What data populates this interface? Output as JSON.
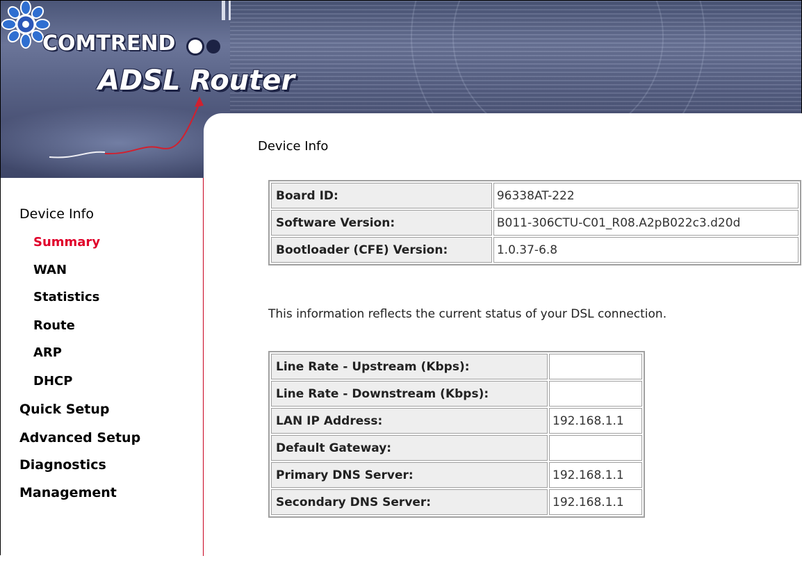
{
  "header": {
    "brand": "COMTREND",
    "product": "ADSL Router"
  },
  "sidebar": {
    "items": [
      {
        "label": "Device Info",
        "level": "top",
        "active": false
      },
      {
        "label": "Summary",
        "level": "sub",
        "active": true
      },
      {
        "label": "WAN",
        "level": "sub",
        "active": false
      },
      {
        "label": "Statistics",
        "level": "sub",
        "active": false
      },
      {
        "label": "Route",
        "level": "sub",
        "active": false
      },
      {
        "label": "ARP",
        "level": "sub",
        "active": false
      },
      {
        "label": "DHCP",
        "level": "sub",
        "active": false
      },
      {
        "label": "Quick Setup",
        "level": "top",
        "active": false
      },
      {
        "label": "Advanced Setup",
        "level": "top",
        "active": false
      },
      {
        "label": "Diagnostics",
        "level": "top",
        "active": false
      },
      {
        "label": "Management",
        "level": "top",
        "active": false
      }
    ]
  },
  "main": {
    "title": "Device Info",
    "device_table": [
      {
        "label": "Board ID:",
        "value": "96338AT-222"
      },
      {
        "label": "Software Version:",
        "value": "B011-306CTU-C01_R08.A2pB022c3.d20d"
      },
      {
        "label": "Bootloader (CFE) Version:",
        "value": "1.0.37-6.8"
      }
    ],
    "status_note": "This information reflects the current status of your DSL connection.",
    "status_table": [
      {
        "label": "Line Rate - Upstream (Kbps):",
        "value": ""
      },
      {
        "label": "Line Rate - Downstream (Kbps):",
        "value": ""
      },
      {
        "label": "LAN IP Address:",
        "value": "192.168.1.1"
      },
      {
        "label": "Default Gateway:",
        "value": ""
      },
      {
        "label": "Primary DNS Server:",
        "value": "192.168.1.1"
      },
      {
        "label": "Secondary DNS Server:",
        "value": "192.168.1.1"
      }
    ]
  },
  "colors": {
    "accent": "#e0002a",
    "banner": "#4b5678",
    "label_bg": "#eeeeee",
    "border": "#a0a0a0"
  },
  "icons": {
    "logo": "comtrend-flower-logo-icon",
    "arrow": "growth-arrow-icon"
  }
}
